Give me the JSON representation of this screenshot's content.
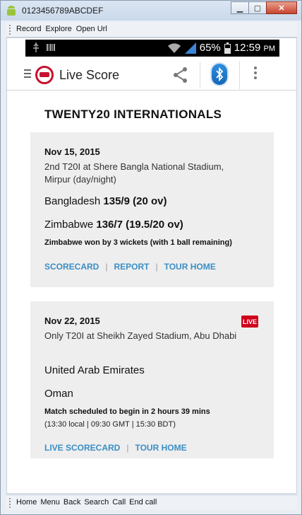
{
  "window": {
    "title": "0123456789ABCDEF",
    "close_glyph": "✕",
    "minimize_glyph": "▁",
    "maximize_glyph": "▢"
  },
  "toolbar": {
    "items": [
      "Record",
      "Explore",
      "Open Url"
    ]
  },
  "statusbar": {
    "battery_pct": "65%",
    "time": "12:59",
    "ampm": "PM"
  },
  "appbar": {
    "title": "Live Score"
  },
  "section_title": "TWENTY20 INTERNATIONALS",
  "matches": [
    {
      "date": "Nov 15, 2015",
      "venue": "2nd T20I at Shere Bangla National Stadium, Mirpur (day/night)",
      "team1_name": "Bangladesh",
      "team1_score": "135/9 (20 ov)",
      "team2_name": "Zimbabwe",
      "team2_score": "136/7 (19.5/20 ov)",
      "result": "Zimbabwe won by 3 wickets (with 1 ball remaining)",
      "links": [
        "SCORECARD",
        "REPORT",
        "TOUR HOME"
      ]
    },
    {
      "date": "Nov 22, 2015",
      "badge": "LIVE",
      "venue": "Only T20I at Sheikh Zayed Stadium, Abu Dhabi",
      "team1_name": "United Arab Emirates",
      "team2_name": "Oman",
      "result": "Match scheduled to begin in 2 hours 39 mins",
      "times": "(13:30 local | 09:30 GMT | 15:30 BDT)",
      "links": [
        "LIVE SCORECARD",
        "TOUR HOME"
      ]
    }
  ],
  "bottombar": {
    "items": [
      "Home",
      "Menu",
      "Back",
      "Search",
      "Call",
      "End call"
    ]
  },
  "colors": {
    "accent": "#3a8ec5",
    "live_red": "#d0021b",
    "card_bg": "#eeeeee"
  }
}
